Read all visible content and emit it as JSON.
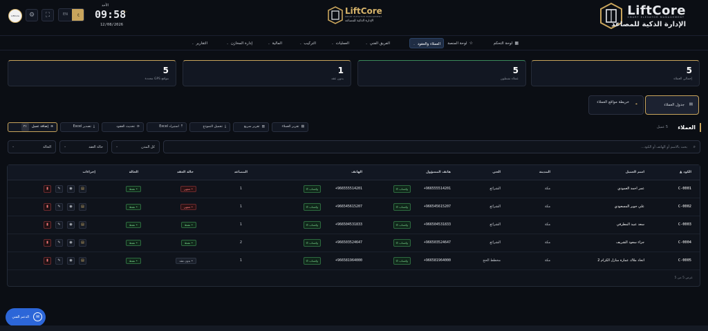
{
  "brand": {
    "name": "LiftCore",
    "tagline": "SMART ELEVATOR MANAGEMENT",
    "arabic": "الإدارة الذكية للمصاعد",
    "center_tagline": "SMART ELEVATOR MANAGEMENT",
    "center_arabic": "الإدارة الذكية للمصاعد"
  },
  "header": {
    "avatar_text": "LiftCore",
    "lang_en": "EN",
    "lang_ar": "ع",
    "day": "الأحد",
    "time": "09:58",
    "sec": "٤٠",
    "date": "12/08/2026"
  },
  "nav": [
    {
      "label": "لوحة التحكم",
      "icon": "▦",
      "chevron": false,
      "active": false
    },
    {
      "label": "لوحة المنصة",
      "icon": "☆",
      "chevron": false,
      "active": false
    },
    {
      "label": "العملاء والعقود",
      "icon": "",
      "chevron": true,
      "active": true
    },
    {
      "label": "الفريق الفني",
      "icon": "",
      "chevron": true,
      "active": false
    },
    {
      "label": "العمليات",
      "icon": "",
      "chevron": true,
      "active": false
    },
    {
      "label": "التركيب",
      "icon": "",
      "chevron": true,
      "active": false
    },
    {
      "label": "المالية",
      "icon": "",
      "chevron": true,
      "active": false
    },
    {
      "label": "إدارة المخازن",
      "icon": "",
      "chevron": true,
      "active": false
    },
    {
      "label": "التقارير",
      "icon": "",
      "chevron": true,
      "active": false
    }
  ],
  "stats": [
    {
      "value": "5",
      "label": "إجمالي العملاء"
    },
    {
      "value": "5",
      "label": "عملاء نشطون"
    },
    {
      "value": "1",
      "label": "بدون عقد"
    },
    {
      "value": "5",
      "label": "مواقع GPS محددة"
    }
  ],
  "views": {
    "table": "جدول العملاء",
    "map": "خريطة مواقع العملاء"
  },
  "section": {
    "title": "العملاء",
    "count": "5 عميل"
  },
  "toolbar": {
    "report": "تقرير العملاء",
    "quick_report": "تقرير سريع",
    "download_template": "تحميل النموذج",
    "import": "استيراد Excel",
    "update_contracts": "تحديث العقود",
    "export": "تصدير Excel",
    "add": "إضافة عميل",
    "add_count": "٢١"
  },
  "filters": {
    "search_placeholder": "بحث بالاسم أو الهاتف أو الكود...",
    "city": "كل المدن",
    "contract": "حالة العقد",
    "status": "الحالة"
  },
  "table": {
    "headers": {
      "code": "الكود",
      "name": "اسم العميل",
      "city": "المدينة",
      "district": "الحي",
      "resp_phone": "هاتف المسؤول",
      "phone": "الهاتف",
      "elevators": "المصاعد",
      "contract": "حالة العقد",
      "status": "الحالة",
      "actions": "إجراءات"
    },
    "whatsapp": "واتساب",
    "rows": [
      {
        "code": "C-0001",
        "name": "عمر احمد العمودي",
        "city": "مكة",
        "district": "الشرائع",
        "resp_phone": "+966555514201",
        "phone": "+966555514201",
        "elevators": "1",
        "contract": "منتهي",
        "contract_type": "red",
        "status": "نشط"
      },
      {
        "code": "C-0002",
        "name": "علي جوير المسعودي",
        "city": "مكة",
        "district": "الشرائع",
        "resp_phone": "+966545615207",
        "phone": "+966545615207",
        "elevators": "1",
        "contract": "منتهي",
        "contract_type": "red",
        "status": "نشط"
      },
      {
        "code": "C-0003",
        "name": "سعد عبيد المطرفي",
        "city": "مكة",
        "district": "الشرائع",
        "resp_phone": "+966504531833",
        "phone": "+966504531833",
        "elevators": "1",
        "contract": "نشط",
        "contract_type": "green",
        "status": "نشط"
      },
      {
        "code": "C-0004",
        "name": "جزاء سعود الشريف",
        "city": "مكة",
        "district": "الشرائع",
        "resp_phone": "+966503524647",
        "phone": "+966503524647",
        "elevators": "2",
        "contract": "نشط",
        "contract_type": "green",
        "status": "نشط"
      },
      {
        "code": "C-0005",
        "name": "اتحاد ملاك عمارة منازل الكرام 2",
        "city": "مكة",
        "district": "مخطط الحج",
        "resp_phone": "+966581964000",
        "phone": "+966581964000",
        "elevators": "1",
        "contract": "بدون عقد",
        "contract_type": "gray",
        "status": "نشط"
      }
    ],
    "footer": "عرض 5 من 5"
  },
  "support": {
    "label": "الدعم الفني"
  },
  "colors": {
    "accent": "#c9a55c",
    "bg": "#0b0e14",
    "card": "#121722",
    "success": "#7bd88f",
    "danger": "#ff7b7b",
    "support": "#2c66d8"
  }
}
